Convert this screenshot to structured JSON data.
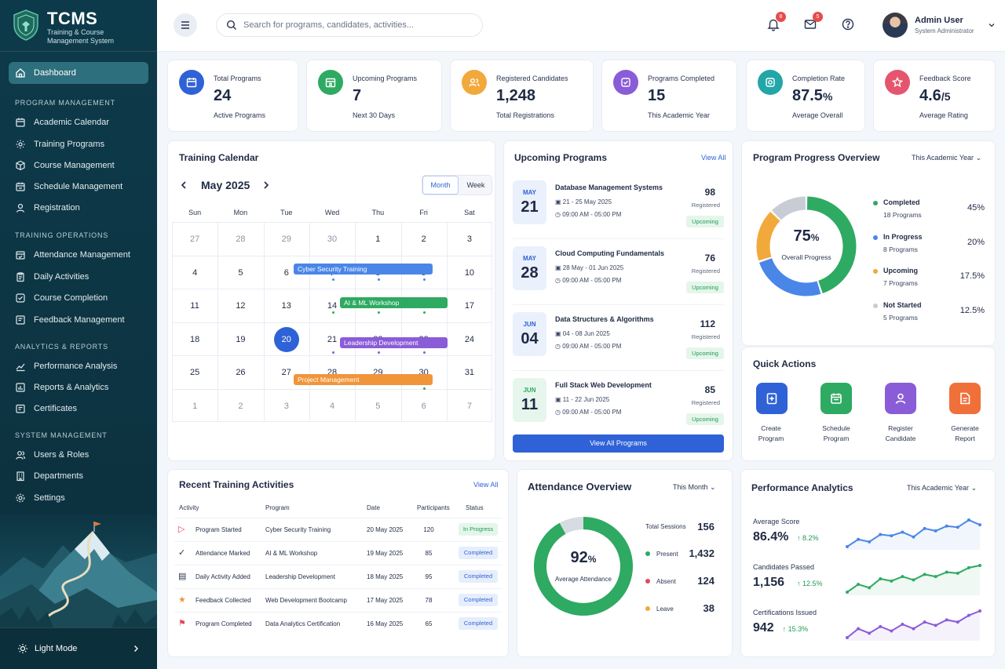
{
  "brand": {
    "name": "TCMS",
    "subtitle_1": "Training & Course",
    "subtitle_2": "Management System"
  },
  "sidebar": {
    "active": "Dashboard",
    "sections": [
      {
        "title": "PROGRAM MANAGEMENT",
        "items": [
          "Academic Calendar",
          "Training Programs",
          "Course Management",
          "Schedule Management",
          "Registration"
        ]
      },
      {
        "title": "TRAINING OPERATIONS",
        "items": [
          "Attendance Management",
          "Daily Activities",
          "Course Completion",
          "Feedback Management"
        ]
      },
      {
        "title": "ANALYTICS & REPORTS",
        "items": [
          "Performance Analysis",
          "Reports & Analytics",
          "Certificates"
        ]
      },
      {
        "title": "SYSTEM MANAGEMENT",
        "items": [
          "Users & Roles",
          "Departments",
          "Settings"
        ]
      }
    ],
    "mode_label": "Light Mode"
  },
  "topbar": {
    "search_placeholder": "Search for programs, candidates, activities...",
    "notifications": "8",
    "messages": "5",
    "user_name": "Admin User",
    "user_role": "System Administrator"
  },
  "stats": [
    {
      "label": "Total Programs",
      "value": "24",
      "suffix": "",
      "sub": "Active Programs",
      "color": "#2f62d6"
    },
    {
      "label": "Upcoming Programs",
      "value": "7",
      "suffix": "",
      "sub": "Next 30 Days",
      "color": "#2eaa62"
    },
    {
      "label": "Registered Candidates",
      "value": "1,248",
      "suffix": "",
      "sub": "Total Registrations",
      "color": "#f2a93b"
    },
    {
      "label": "Programs Completed",
      "value": "15",
      "suffix": "",
      "sub": "This Academic Year",
      "color": "#8a5cd8"
    },
    {
      "label": "Completion Rate",
      "value": "87.5",
      "suffix": "%",
      "sub": "Average Overall",
      "color": "#22a6a8"
    },
    {
      "label": "Feedback Score",
      "value": "4.6",
      "suffix": "/5",
      "sub": "Average Rating",
      "color": "#e5566e"
    }
  ],
  "calendar": {
    "title": "Training Calendar",
    "month": "May 2025",
    "view_month": "Month",
    "view_week": "Week",
    "weekdays": [
      "Sun",
      "Mon",
      "Tue",
      "Wed",
      "Thu",
      "Fri",
      "Sat"
    ],
    "weeks": [
      [
        "27",
        "28",
        "29",
        "30",
        "1",
        "2",
        "3"
      ],
      [
        "4",
        "5",
        "6",
        "7",
        "8",
        "9",
        "10"
      ],
      [
        "11",
        "12",
        "13",
        "14",
        "15",
        "16",
        "17"
      ],
      [
        "18",
        "19",
        "20",
        "21",
        "22",
        "23",
        "24"
      ],
      [
        "25",
        "26",
        "27",
        "28",
        "29",
        "30",
        "31"
      ],
      [
        "1",
        "2",
        "3",
        "4",
        "5",
        "6",
        "7"
      ]
    ],
    "today": "20",
    "events": [
      {
        "name": "Cyber Security Training",
        "color": "#4a86e8"
      },
      {
        "name": "AI & ML Workshop",
        "color": "#2eaa62"
      },
      {
        "name": "Leadership Development",
        "color": "#8a5cd8"
      },
      {
        "name": "Project Management",
        "color": "#f0953a"
      }
    ]
  },
  "upcoming": {
    "title": "Upcoming Programs",
    "view_all": "View All",
    "button": "View All Programs",
    "items": [
      {
        "month": "MAY",
        "day": "21",
        "name": "Database Management Systems",
        "dates": "21 - 25 May 2025",
        "time": "09:00 AM - 05:00 PM",
        "count": "98",
        "count_label": "Registered",
        "status": "Upcoming",
        "color": "#2f62d6",
        "bg": "#eaf0fc"
      },
      {
        "month": "MAY",
        "day": "28",
        "name": "Cloud Computing Fundamentals",
        "dates": "28 May - 01 Jun 2025",
        "time": "09:00 AM - 05:00 PM",
        "count": "76",
        "count_label": "Registered",
        "status": "Upcoming",
        "color": "#2f62d6",
        "bg": "#eaf0fc"
      },
      {
        "month": "JUN",
        "day": "04",
        "name": "Data Structures & Algorithms",
        "dates": "04 - 08 Jun 2025",
        "time": "09:00 AM - 05:00 PM",
        "count": "112",
        "count_label": "Registered",
        "status": "Upcoming",
        "color": "#2f62d6",
        "bg": "#eaf0fc"
      },
      {
        "month": "JUN",
        "day": "11",
        "name": "Full Stack Web Development",
        "dates": "11 - 22 Jun 2025",
        "time": "09:00 AM - 05:00 PM",
        "count": "85",
        "count_label": "Registered",
        "status": "Upcoming",
        "color": "#2eaa62",
        "bg": "#e7f6ec"
      }
    ]
  },
  "progress": {
    "title": "Program Progress Overview",
    "period": "This Academic Year",
    "center_value": "75",
    "center_suffix": "%",
    "center_label": "Overall Progress",
    "items": [
      {
        "name": "Completed",
        "sub": "18 Programs",
        "percent": "45%",
        "value": 45,
        "color": "#2eaa62"
      },
      {
        "name": "In Progress",
        "sub": "8 Programs",
        "percent": "20%",
        "value": 20,
        "color": "#4a86e8"
      },
      {
        "name": "Upcoming",
        "sub": "7 Programs",
        "percent": "17.5%",
        "value": 17.5,
        "color": "#f2a93b"
      },
      {
        "name": "Not Started",
        "sub": "5 Programs",
        "percent": "12.5%",
        "value": 12.5,
        "color": "#c8ccd4"
      }
    ]
  },
  "quick_actions": {
    "title": "Quick Actions",
    "items": [
      {
        "line1": "Create",
        "line2": "Program",
        "color": "#2f62d6"
      },
      {
        "line1": "Schedule",
        "line2": "Program",
        "color": "#2eaa62"
      },
      {
        "line1": "Register",
        "line2": "Candidate",
        "color": "#8a5cd8"
      },
      {
        "line1": "Generate",
        "line2": "Report",
        "color": "#f0703a"
      }
    ]
  },
  "activities": {
    "title": "Recent Training Activities",
    "view_all": "View All",
    "headers": [
      "Activity",
      "Program",
      "Date",
      "Participants",
      "Status"
    ],
    "rows": [
      {
        "activity": "Program Started",
        "program": "Cyber Security Training",
        "date": "20 May 2025",
        "participants": "120",
        "status": "In Progress",
        "icon": "play-icon"
      },
      {
        "activity": "Attendance Marked",
        "program": "AI & ML Workshop",
        "date": "19 May 2025",
        "participants": "85",
        "status": "Completed",
        "icon": "check-circle-icon"
      },
      {
        "activity": "Daily Activity Added",
        "program": "Leadership Development",
        "date": "18 May 2025",
        "participants": "95",
        "status": "Completed",
        "icon": "document-icon"
      },
      {
        "activity": "Feedback Collected",
        "program": "Web Development Bootcamp",
        "date": "17 May 2025",
        "participants": "78",
        "status": "Completed",
        "icon": "star-icon"
      },
      {
        "activity": "Program Completed",
        "program": "Data Analytics Certification",
        "date": "16 May 2025",
        "participants": "65",
        "status": "Completed",
        "icon": "flag-icon"
      }
    ]
  },
  "attendance": {
    "title": "Attendance Overview",
    "period": "This Month",
    "center_value": "92",
    "center_suffix": "%",
    "center_label": "Average Attendance",
    "total_label": "Total Sessions",
    "total_value": "156",
    "items": [
      {
        "name": "Present",
        "value": "1,432",
        "color": "#2eaa62"
      },
      {
        "name": "Absent",
        "value": "124",
        "color": "#e5485a"
      },
      {
        "name": "Leave",
        "value": "38",
        "color": "#f2a93b"
      }
    ]
  },
  "performance": {
    "title": "Performance Analytics",
    "period": "This Academic Year",
    "metrics": [
      {
        "label": "Average Score",
        "value": "86.4%",
        "change": "8.2%",
        "color": "#4a86e8",
        "series": [
          40,
          46,
          44,
          50,
          49,
          52,
          48,
          55,
          53,
          57,
          56,
          62,
          58
        ]
      },
      {
        "label": "Candidates Passed",
        "value": "1,156",
        "change": "12.5%",
        "color": "#2eaa62",
        "series": [
          38,
          45,
          42,
          50,
          48,
          52,
          49,
          54,
          52,
          56,
          55,
          60,
          62
        ]
      },
      {
        "label": "Certifications Issued",
        "value": "942",
        "change": "15.3%",
        "color": "#8a5cd8",
        "series": [
          30,
          38,
          34,
          40,
          36,
          42,
          38,
          44,
          41,
          46,
          44,
          50,
          54
        ]
      }
    ]
  }
}
